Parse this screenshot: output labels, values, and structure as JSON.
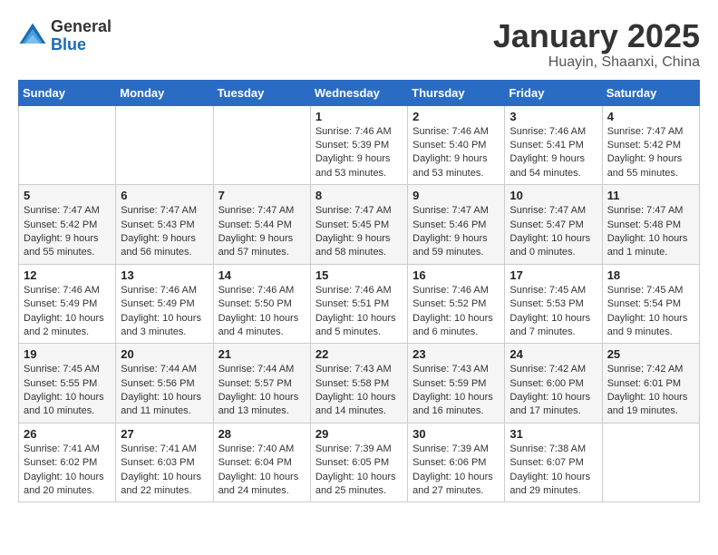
{
  "header": {
    "logo_general": "General",
    "logo_blue": "Blue",
    "title": "January 2025",
    "subtitle": "Huayin, Shaanxi, China"
  },
  "days_of_week": [
    "Sunday",
    "Monday",
    "Tuesday",
    "Wednesday",
    "Thursday",
    "Friday",
    "Saturday"
  ],
  "weeks": [
    [
      {
        "day": "",
        "info": ""
      },
      {
        "day": "",
        "info": ""
      },
      {
        "day": "",
        "info": ""
      },
      {
        "day": "1",
        "info": "Sunrise: 7:46 AM\nSunset: 5:39 PM\nDaylight: 9 hours and 53 minutes."
      },
      {
        "day": "2",
        "info": "Sunrise: 7:46 AM\nSunset: 5:40 PM\nDaylight: 9 hours and 53 minutes."
      },
      {
        "day": "3",
        "info": "Sunrise: 7:46 AM\nSunset: 5:41 PM\nDaylight: 9 hours and 54 minutes."
      },
      {
        "day": "4",
        "info": "Sunrise: 7:47 AM\nSunset: 5:42 PM\nDaylight: 9 hours and 55 minutes."
      }
    ],
    [
      {
        "day": "5",
        "info": "Sunrise: 7:47 AM\nSunset: 5:42 PM\nDaylight: 9 hours and 55 minutes."
      },
      {
        "day": "6",
        "info": "Sunrise: 7:47 AM\nSunset: 5:43 PM\nDaylight: 9 hours and 56 minutes."
      },
      {
        "day": "7",
        "info": "Sunrise: 7:47 AM\nSunset: 5:44 PM\nDaylight: 9 hours and 57 minutes."
      },
      {
        "day": "8",
        "info": "Sunrise: 7:47 AM\nSunset: 5:45 PM\nDaylight: 9 hours and 58 minutes."
      },
      {
        "day": "9",
        "info": "Sunrise: 7:47 AM\nSunset: 5:46 PM\nDaylight: 9 hours and 59 minutes."
      },
      {
        "day": "10",
        "info": "Sunrise: 7:47 AM\nSunset: 5:47 PM\nDaylight: 10 hours and 0 minutes."
      },
      {
        "day": "11",
        "info": "Sunrise: 7:47 AM\nSunset: 5:48 PM\nDaylight: 10 hours and 1 minute."
      }
    ],
    [
      {
        "day": "12",
        "info": "Sunrise: 7:46 AM\nSunset: 5:49 PM\nDaylight: 10 hours and 2 minutes."
      },
      {
        "day": "13",
        "info": "Sunrise: 7:46 AM\nSunset: 5:49 PM\nDaylight: 10 hours and 3 minutes."
      },
      {
        "day": "14",
        "info": "Sunrise: 7:46 AM\nSunset: 5:50 PM\nDaylight: 10 hours and 4 minutes."
      },
      {
        "day": "15",
        "info": "Sunrise: 7:46 AM\nSunset: 5:51 PM\nDaylight: 10 hours and 5 minutes."
      },
      {
        "day": "16",
        "info": "Sunrise: 7:46 AM\nSunset: 5:52 PM\nDaylight: 10 hours and 6 minutes."
      },
      {
        "day": "17",
        "info": "Sunrise: 7:45 AM\nSunset: 5:53 PM\nDaylight: 10 hours and 7 minutes."
      },
      {
        "day": "18",
        "info": "Sunrise: 7:45 AM\nSunset: 5:54 PM\nDaylight: 10 hours and 9 minutes."
      }
    ],
    [
      {
        "day": "19",
        "info": "Sunrise: 7:45 AM\nSunset: 5:55 PM\nDaylight: 10 hours and 10 minutes."
      },
      {
        "day": "20",
        "info": "Sunrise: 7:44 AM\nSunset: 5:56 PM\nDaylight: 10 hours and 11 minutes."
      },
      {
        "day": "21",
        "info": "Sunrise: 7:44 AM\nSunset: 5:57 PM\nDaylight: 10 hours and 13 minutes."
      },
      {
        "day": "22",
        "info": "Sunrise: 7:43 AM\nSunset: 5:58 PM\nDaylight: 10 hours and 14 minutes."
      },
      {
        "day": "23",
        "info": "Sunrise: 7:43 AM\nSunset: 5:59 PM\nDaylight: 10 hours and 16 minutes."
      },
      {
        "day": "24",
        "info": "Sunrise: 7:42 AM\nSunset: 6:00 PM\nDaylight: 10 hours and 17 minutes."
      },
      {
        "day": "25",
        "info": "Sunrise: 7:42 AM\nSunset: 6:01 PM\nDaylight: 10 hours and 19 minutes."
      }
    ],
    [
      {
        "day": "26",
        "info": "Sunrise: 7:41 AM\nSunset: 6:02 PM\nDaylight: 10 hours and 20 minutes."
      },
      {
        "day": "27",
        "info": "Sunrise: 7:41 AM\nSunset: 6:03 PM\nDaylight: 10 hours and 22 minutes."
      },
      {
        "day": "28",
        "info": "Sunrise: 7:40 AM\nSunset: 6:04 PM\nDaylight: 10 hours and 24 minutes."
      },
      {
        "day": "29",
        "info": "Sunrise: 7:39 AM\nSunset: 6:05 PM\nDaylight: 10 hours and 25 minutes."
      },
      {
        "day": "30",
        "info": "Sunrise: 7:39 AM\nSunset: 6:06 PM\nDaylight: 10 hours and 27 minutes."
      },
      {
        "day": "31",
        "info": "Sunrise: 7:38 AM\nSunset: 6:07 PM\nDaylight: 10 hours and 29 minutes."
      },
      {
        "day": "",
        "info": ""
      }
    ]
  ]
}
